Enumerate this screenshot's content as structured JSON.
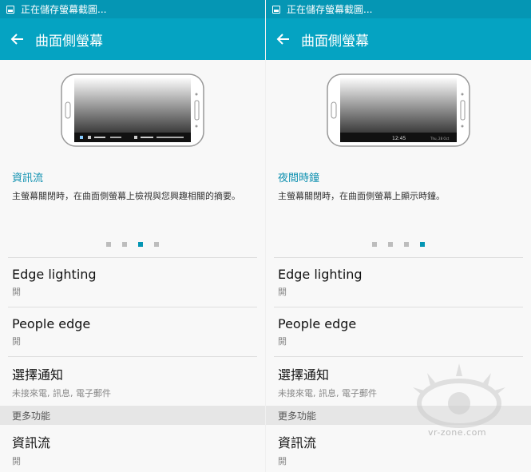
{
  "status_text": "正在儲存螢幕截圖...",
  "app_title": "曲面側螢幕",
  "left": {
    "feature_title": "資訊流",
    "feature_desc": "主螢幕關閉時，在曲面側螢幕上檢視與您興趣相關的摘要。",
    "page_index": 3,
    "page_count": 4
  },
  "right": {
    "feature_title": "夜間時鐘",
    "feature_desc": "主螢幕關閉時，在曲面側螢幕上顯示時鐘。",
    "page_index": 4,
    "page_count": 4,
    "clock_time": "12:45",
    "clock_date": "Thu, 28 Oct"
  },
  "settings": [
    {
      "title": "Edge lighting",
      "value": "開"
    },
    {
      "title": "People edge",
      "value": "開"
    },
    {
      "title": "選擇通知",
      "value": "未接來電, 訊息, 電子郵件"
    }
  ],
  "more_header": "更多功能",
  "more_items": [
    {
      "title": "資訊流",
      "value": "開"
    }
  ],
  "watermark": "vr-zone.com",
  "colors": {
    "appbar": "#05a3c2",
    "statusbar": "#0596b4",
    "accent": "#0b8faf"
  }
}
